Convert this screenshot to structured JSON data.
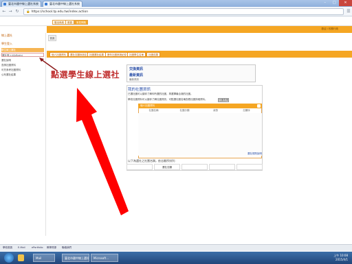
{
  "browser": {
    "tabs": [
      "臺北市國中線上選社系統",
      "臺北市國中線上選社系統"
    ],
    "url": "https://school.tp.edu.tw/index.action"
  },
  "app": {
    "top_buttons": [
      "登出系統",
      "首頁",
      "常見問題"
    ],
    "main_tab": "首頁",
    "user_info": "歡迎 / 校務行政"
  },
  "sidebar": {
    "head1": "線上選社",
    "head2": "學生登入",
    "items": [
      "學生線上選社",
      "選社登入(ID/Birth)",
      "選社說明",
      "查詢社團資料",
      "可先參考社團資料",
      "公布選社結果"
    ]
  },
  "subnav": [
    "個人社團資料",
    "選社志願序設定",
    "社團選社結果",
    "歷年社團參與紀錄",
    "社團學生名單",
    "社團成果"
  ],
  "info": {
    "link1": "交換資訊",
    "link2": "最新資訊",
    "sub": "最新資訊"
  },
  "club": {
    "title": "我的社團資訊",
    "line1": "已選社團可以讓你了解你所選的社團，再選擇最合適的社團。",
    "line2": "學校社團資料可以讓你了解社團資訊，可點選社團名稱查看社團詳細資料。",
    "query_btn": "社團查詢",
    "table_title": "個人社團資料",
    "columns": [
      "社團名稱",
      "社團分類",
      "狀態",
      "志願序"
    ],
    "table_footer": "選社規則說明",
    "select_label": "以下為選社之社團名稱，依志願序排列：",
    "select_cells": [
      "",
      "選社志願",
      "",
      "",
      ""
    ]
  },
  "annotation": "點選學生線上選社",
  "bottom_links": [
    "學校首頁",
    "E-Mail",
    "ePortfolio",
    "教學資源",
    "聯絡我們"
  ],
  "taskbar": {
    "tasks": [
      "Mail",
      "臺北市國中線上選社...",
      "Microsoft..."
    ],
    "time": "上午 10:08",
    "date": "2015/4/1"
  }
}
